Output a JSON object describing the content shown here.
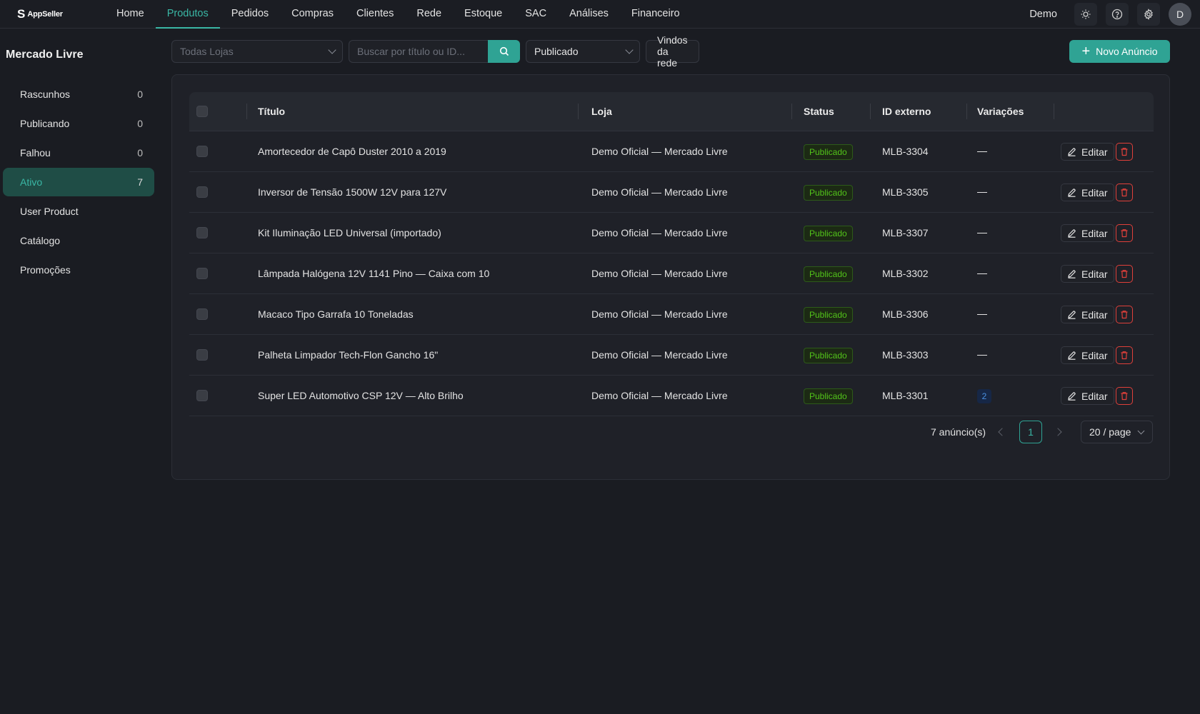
{
  "app": {
    "logo_text": "AppSeller",
    "logo_mark": "S"
  },
  "nav": {
    "items": [
      {
        "label": "Home"
      },
      {
        "label": "Produtos"
      },
      {
        "label": "Pedidos"
      },
      {
        "label": "Compras"
      },
      {
        "label": "Clientes"
      },
      {
        "label": "Rede"
      },
      {
        "label": "Estoque"
      },
      {
        "label": "SAC"
      },
      {
        "label": "Análises"
      },
      {
        "label": "Financeiro"
      }
    ],
    "active": "Produtos",
    "user_label": "Demo",
    "avatar_letter": "D",
    "icons": [
      "sun-icon",
      "help-circle-icon",
      "gear-icon"
    ]
  },
  "sidebar": {
    "title": "Mercado Livre",
    "items": [
      {
        "label": "Rascunhos",
        "count": "0"
      },
      {
        "label": "Publicando",
        "count": "0"
      },
      {
        "label": "Falhou",
        "count": "0"
      },
      {
        "label": "Ativo",
        "count": "7",
        "active": true
      },
      {
        "label": "User Product",
        "count": ""
      },
      {
        "label": "Catálogo",
        "count": ""
      },
      {
        "label": "Promoções",
        "count": ""
      }
    ]
  },
  "toolbar": {
    "store_placeholder": "Todas Lojas",
    "search_placeholder": "Buscar por título ou ID...",
    "status_value": "Publicado",
    "network_button": "Vindos da rede",
    "new_button": "Novo Anúncio"
  },
  "table": {
    "headers": {
      "title": "Título",
      "store": "Loja",
      "status": "Status",
      "external_id": "ID externo",
      "variations": "Variações"
    },
    "edit_label": "Editar",
    "rows": [
      {
        "title": "Amortecedor de Capô Duster 2010 a 2019",
        "store": "Demo Oficial — Mercado Livre",
        "status": "Publicado",
        "external_id": "MLB-3304",
        "variations": ""
      },
      {
        "title": "Inversor de Tensão 1500W 12V para 127V",
        "store": "Demo Oficial — Mercado Livre",
        "status": "Publicado",
        "external_id": "MLB-3305",
        "variations": ""
      },
      {
        "title": "Kit Iluminação LED Universal (importado)",
        "store": "Demo Oficial — Mercado Livre",
        "status": "Publicado",
        "external_id": "MLB-3307",
        "variations": ""
      },
      {
        "title": "Lâmpada Halógena 12V 1141 Pino — Caixa com 10",
        "store": "Demo Oficial — Mercado Livre",
        "status": "Publicado",
        "external_id": "MLB-3302",
        "variations": ""
      },
      {
        "title": "Macaco Tipo Garrafa 10 Toneladas",
        "store": "Demo Oficial — Mercado Livre",
        "status": "Publicado",
        "external_id": "MLB-3306",
        "variations": ""
      },
      {
        "title": "Palheta Limpador Tech-Flon Gancho 16\"",
        "store": "Demo Oficial — Mercado Livre",
        "status": "Publicado",
        "external_id": "MLB-3303",
        "variations": ""
      },
      {
        "title": "Super LED Automotivo CSP 12V — Alto Brilho",
        "store": "Demo Oficial — Mercado Livre",
        "status": "Publicado",
        "external_id": "MLB-3301",
        "variations": "2"
      }
    ]
  },
  "pagination": {
    "total": "7 anúncio(s)",
    "current_page": "1",
    "page_size": "20 / page"
  },
  "colors": {
    "accent": "#2fa394",
    "background": "#1a1c22",
    "success": "#52c41a",
    "danger": "#e0403a"
  }
}
